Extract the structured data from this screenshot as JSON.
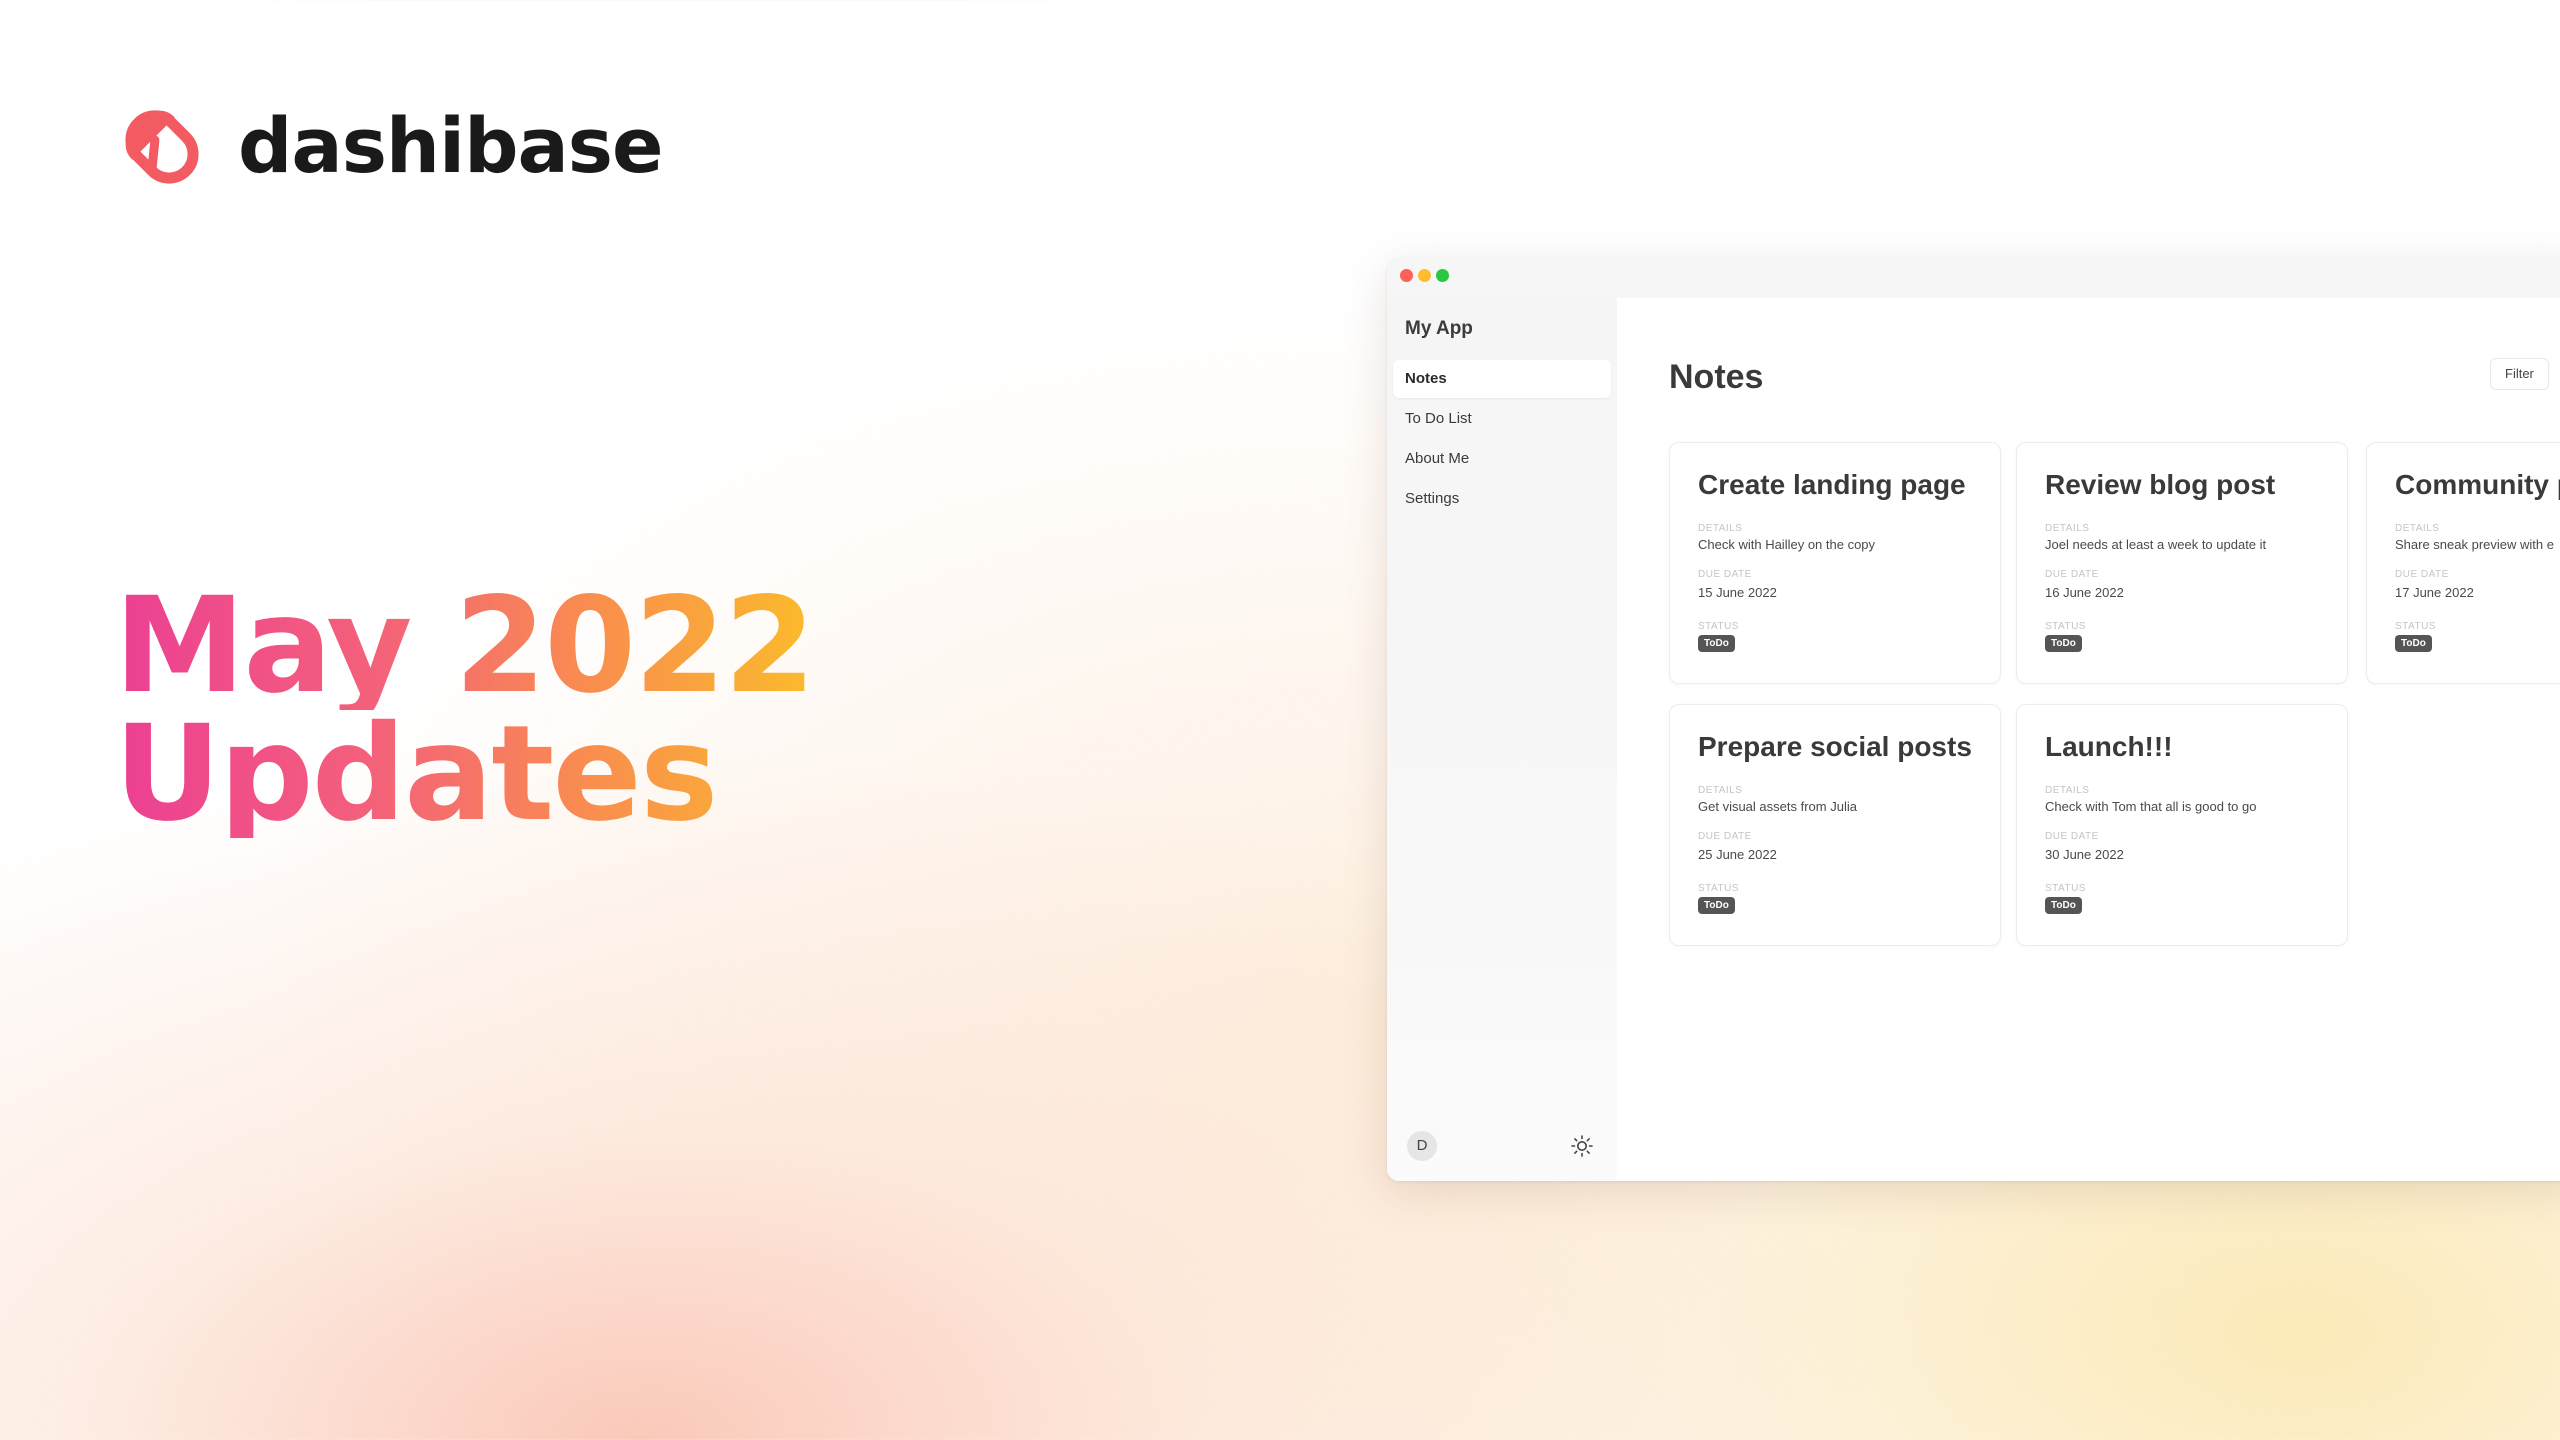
{
  "brand": {
    "name": "dashibase"
  },
  "hero": {
    "line1": "May 2022",
    "line2": "Updates"
  },
  "app": {
    "sidebar": {
      "title": "My App",
      "items": [
        {
          "label": "Notes",
          "active": true
        },
        {
          "label": "To Do List",
          "active": false
        },
        {
          "label": "About Me",
          "active": false
        },
        {
          "label": "Settings",
          "active": false
        }
      ],
      "avatar_initial": "D",
      "theme_icon": "sun-icon"
    },
    "main": {
      "title": "Notes",
      "filter_label": "Filter",
      "field_labels": {
        "details": "DETAILS",
        "due_date": "DUE DATE",
        "status": "STATUS"
      },
      "cards": [
        {
          "title": "Create landing page",
          "details": "Check with Hailley on the copy",
          "due_date": "15 June 2022",
          "status": "ToDo"
        },
        {
          "title": "Review blog post",
          "details": "Joel needs at least a week to update it",
          "due_date": "16 June 2022",
          "status": "ToDo"
        },
        {
          "title": "Community p",
          "details": "Share sneak preview with e",
          "due_date": "17 June 2022",
          "status": "ToDo"
        },
        {
          "title": "Prepare social posts",
          "details": "Get visual assets from Julia",
          "due_date": "25 June 2022",
          "status": "ToDo"
        },
        {
          "title": "Launch!!!",
          "details": "Check with Tom that all is good to go",
          "due_date": "30 June 2022",
          "status": "ToDo"
        }
      ]
    }
  },
  "colors": {
    "brand_red": "#f25b62",
    "gradient_pink": "#ec3f94",
    "gradient_orange": "#f98e4e",
    "gradient_yellow": "#fbbb2b",
    "badge_bg": "#555555"
  }
}
